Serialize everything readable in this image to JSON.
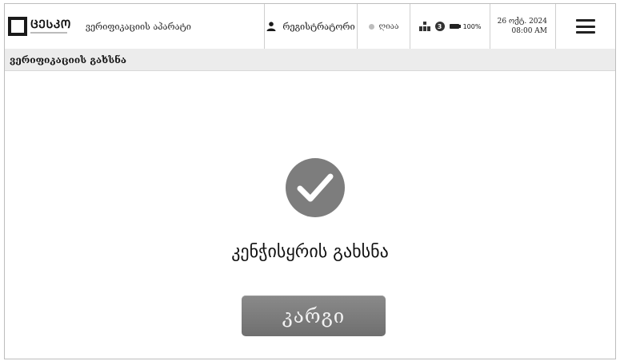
{
  "header": {
    "logo_text": "ᲪᲔᲡᲙᲝ",
    "app_title": "ვერიფიკაციის აპარატი",
    "user_label": "რეგისტრატორი",
    "status_label": "ღიაა",
    "queue_count": "3",
    "battery_label": "100%",
    "date": "26 ოქტ. 2024",
    "time": "08:00 AM"
  },
  "subheader": {
    "title": "ვერიფიკაციის გახსნა"
  },
  "main": {
    "message": "კენჭისყრის გახსნა",
    "ok_label": "კარგი"
  },
  "colors": {
    "check_circle": "#7d7d7d",
    "button_bg": "#7b7b7b",
    "subbar_bg": "#ececec"
  },
  "icons": [
    "logo-icon",
    "user-icon",
    "status-dot-icon",
    "network-icon",
    "battery-icon",
    "menu-icon",
    "checkmark-icon"
  ]
}
